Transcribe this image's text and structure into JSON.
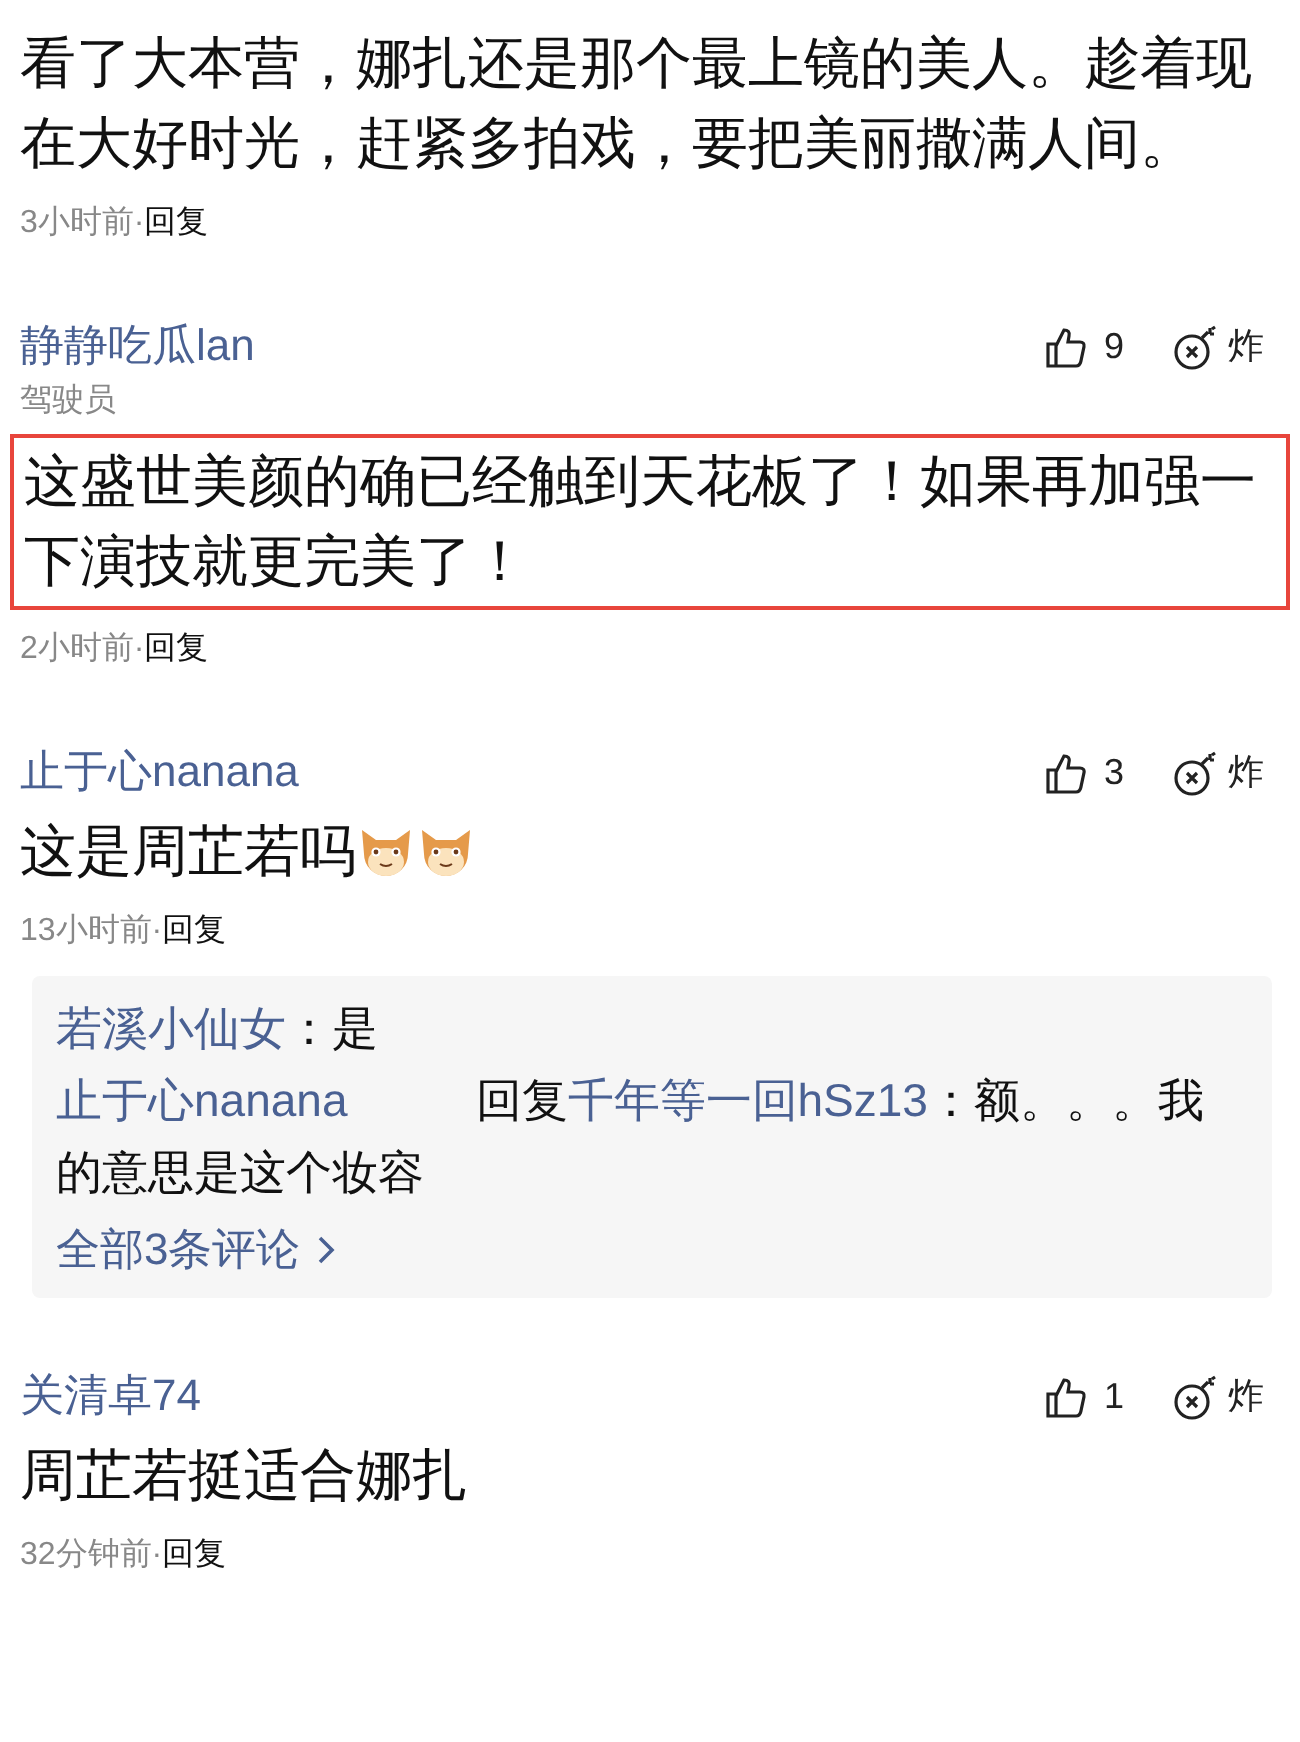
{
  "comments": [
    {
      "text": "看了大本营，娜扎还是那个最上镜的美人。趁着现在大好时光，赶紧多拍戏，要把美丽撒满人间。",
      "highlighted": false,
      "time": "3小时前·",
      "reply": "回复"
    },
    {
      "author": "静静吃瓜lan",
      "badge": "驾驶员",
      "likes": "9",
      "bomb": "炸",
      "text": "这盛世美颜的确已经触到天花板了！如果再加强一下演技就更完美了！",
      "highlighted": true,
      "time": "2小时前·",
      "reply": "回复"
    },
    {
      "author": "止于心nanana",
      "likes": "3",
      "bomb": "炸",
      "text": "这是周芷若吗",
      "emojis": [
        {
          "kind": "cat"
        },
        {
          "kind": "cat"
        }
      ],
      "highlighted": false,
      "time": "13小时前·",
      "reply": "回复",
      "replies": [
        {
          "author": "若溪小仙女",
          "text": "：是"
        },
        {
          "author": "止于心nanana",
          "verb": "回复",
          "target": "千年等一回hSz13",
          "text": "：额。。。我的意思是这个妆容"
        }
      ],
      "more": "全部3条评论"
    },
    {
      "author": "关清卓74",
      "likes": "1",
      "bomb": "炸",
      "text": "周芷若挺适合娜扎",
      "highlighted": false,
      "time": "32分钟前·",
      "reply": "回复"
    }
  ]
}
